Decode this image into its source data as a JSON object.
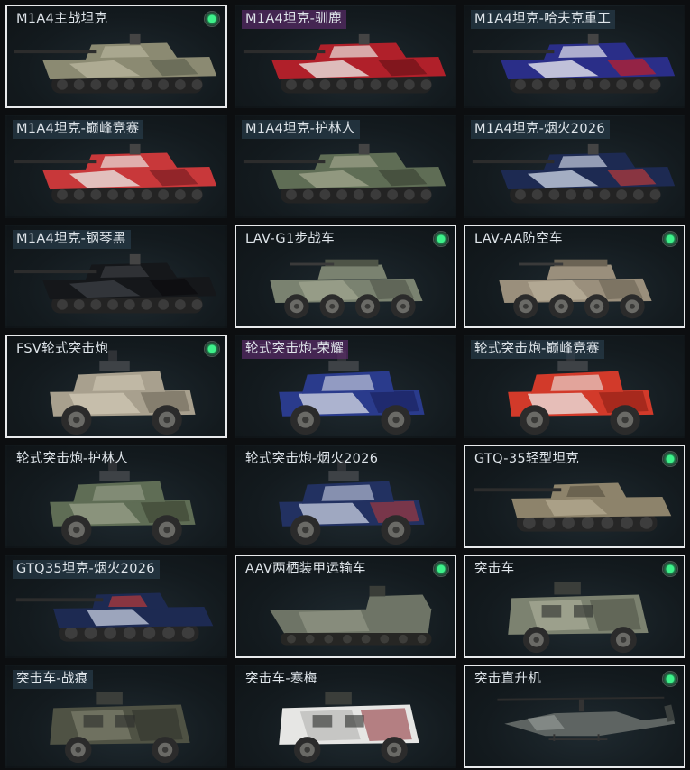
{
  "screen": {
    "background": "#0c0e10",
    "accent_owned": "#3ef08a"
  },
  "items": [
    {
      "label": "M1A4主战坦克",
      "label_style": "none",
      "selected": true,
      "owned": true,
      "vehicle": "tank",
      "camo": [
        "#8b8a72",
        "#b7b39b",
        "#5f6250"
      ]
    },
    {
      "label": "M1A4坦克-驯鹿",
      "label_style": "epic",
      "selected": false,
      "owned": false,
      "vehicle": "tank",
      "camo": [
        "#b0202a",
        "#e9e4e0",
        "#6d1218"
      ]
    },
    {
      "label": "M1A4坦克-哈夫克重工",
      "label_style": "plain",
      "selected": false,
      "owned": false,
      "vehicle": "tank",
      "camo": [
        "#2a2e88",
        "#e6e6ee",
        "#c21f2a"
      ]
    },
    {
      "label": "M1A4坦克-巅峰竞赛",
      "label_style": "plain",
      "selected": false,
      "owned": false,
      "vehicle": "tank",
      "camo": [
        "#c8383a",
        "#e9e2de",
        "#7a1e22"
      ]
    },
    {
      "label": "M1A4坦克-护林人",
      "label_style": "plain",
      "selected": false,
      "owned": false,
      "vehicle": "tank",
      "camo": [
        "#5f6d55",
        "#9ea28a",
        "#3d4636"
      ]
    },
    {
      "label": "M1A4坦克-烟火2026",
      "label_style": "plain",
      "selected": false,
      "owned": false,
      "vehicle": "tank",
      "camo": [
        "#1d2a52",
        "#c7cfe0",
        "#b83a3a"
      ]
    },
    {
      "label": "M1A4坦克-钢琴黑",
      "label_style": "plain",
      "selected": false,
      "owned": false,
      "vehicle": "tank",
      "camo": [
        "#15171a",
        "#3a3d42",
        "#0b0c0e"
      ]
    },
    {
      "label": "LAV-G1步战车",
      "label_style": "none",
      "selected": true,
      "owned": true,
      "vehicle": "apc",
      "camo": [
        "#7a8270",
        "#a2a792",
        "#4e5447"
      ]
    },
    {
      "label": "LAV-AA防空车",
      "label_style": "none",
      "selected": true,
      "owned": true,
      "vehicle": "apc",
      "camo": [
        "#9a8f7c",
        "#bcb29c",
        "#6b6354"
      ]
    },
    {
      "label": "FSV轮式突击炮",
      "label_style": "none",
      "selected": true,
      "owned": true,
      "vehicle": "buggy",
      "camo": [
        "#a8a08e",
        "#d0c8b4",
        "#6e6759"
      ]
    },
    {
      "label": "轮式突击炮-荣耀",
      "label_style": "epic",
      "selected": false,
      "owned": false,
      "vehicle": "buggy",
      "camo": [
        "#2a3b8c",
        "#d8dce6",
        "#19205a"
      ]
    },
    {
      "label": "轮式突击炮-巅峰竞赛",
      "label_style": "plain",
      "selected": false,
      "owned": false,
      "vehicle": "buggy",
      "camo": [
        "#d23a2a",
        "#ecebe8",
        "#8a1e16"
      ]
    },
    {
      "label": "轮式突击炮-护林人",
      "label_style": "none",
      "selected": false,
      "owned": false,
      "vehicle": "buggy",
      "camo": [
        "#5f6d55",
        "#98a08a",
        "#39412f"
      ]
    },
    {
      "label": "轮式突击炮-烟火2026",
      "label_style": "none",
      "selected": false,
      "owned": false,
      "vehicle": "buggy",
      "camo": [
        "#223161",
        "#c9d0e2",
        "#b33a3a"
      ]
    },
    {
      "label": "GTQ-35轻型坦克",
      "label_style": "none",
      "selected": true,
      "owned": true,
      "vehicle": "light_tank",
      "camo": [
        "#8d836b",
        "#b4aa90",
        "#5d5645"
      ]
    },
    {
      "label": "GTQ35坦克-烟火2026",
      "label_style": "plain",
      "selected": false,
      "owned": false,
      "vehicle": "light_tank",
      "camo": [
        "#1d2a52",
        "#c7cfe0",
        "#b83a3a"
      ]
    },
    {
      "label": "AAV两栖装甲运输车",
      "label_style": "none",
      "selected": true,
      "owned": true,
      "vehicle": "amphib",
      "camo": [
        "#6e7466",
        "#979c8a",
        "#474c41"
      ]
    },
    {
      "label": "突击车",
      "label_style": "none",
      "selected": true,
      "owned": true,
      "vehicle": "mrap",
      "camo": [
        "#7c8270",
        "#a9ad98",
        "#4d5245"
      ]
    },
    {
      "label": "突击车-战痕",
      "label_style": "plain",
      "selected": false,
      "owned": false,
      "vehicle": "mrap",
      "camo": [
        "#4f5244",
        "#7e7f6c",
        "#2e302a"
      ]
    },
    {
      "label": "突击车-寒梅",
      "label_style": "none",
      "selected": false,
      "owned": false,
      "vehicle": "mrap",
      "camo": [
        "#e6e6e4",
        "#b8b8b6",
        "#8a2a32"
      ]
    },
    {
      "label": "突击直升机",
      "label_style": "none",
      "selected": true,
      "owned": true,
      "vehicle": "heli",
      "camo": [
        "#5e6462",
        "#8b918e",
        "#3c413f"
      ]
    }
  ]
}
